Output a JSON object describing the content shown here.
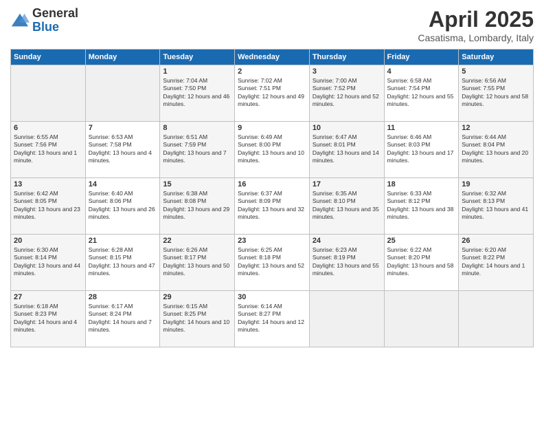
{
  "header": {
    "logo": {
      "general": "General",
      "blue": "Blue"
    },
    "title": "April 2025",
    "subtitle": "Casatisma, Lombardy, Italy"
  },
  "days_of_week": [
    "Sunday",
    "Monday",
    "Tuesday",
    "Wednesday",
    "Thursday",
    "Friday",
    "Saturday"
  ],
  "weeks": [
    [
      null,
      null,
      {
        "day": 1,
        "sunrise": "Sunrise: 7:04 AM",
        "sunset": "Sunset: 7:50 PM",
        "daylight": "Daylight: 12 hours and 46 minutes."
      },
      {
        "day": 2,
        "sunrise": "Sunrise: 7:02 AM",
        "sunset": "Sunset: 7:51 PM",
        "daylight": "Daylight: 12 hours and 49 minutes."
      },
      {
        "day": 3,
        "sunrise": "Sunrise: 7:00 AM",
        "sunset": "Sunset: 7:52 PM",
        "daylight": "Daylight: 12 hours and 52 minutes."
      },
      {
        "day": 4,
        "sunrise": "Sunrise: 6:58 AM",
        "sunset": "Sunset: 7:54 PM",
        "daylight": "Daylight: 12 hours and 55 minutes."
      },
      {
        "day": 5,
        "sunrise": "Sunrise: 6:56 AM",
        "sunset": "Sunset: 7:55 PM",
        "daylight": "Daylight: 12 hours and 58 minutes."
      }
    ],
    [
      {
        "day": 6,
        "sunrise": "Sunrise: 6:55 AM",
        "sunset": "Sunset: 7:56 PM",
        "daylight": "Daylight: 13 hours and 1 minute."
      },
      {
        "day": 7,
        "sunrise": "Sunrise: 6:53 AM",
        "sunset": "Sunset: 7:58 PM",
        "daylight": "Daylight: 13 hours and 4 minutes."
      },
      {
        "day": 8,
        "sunrise": "Sunrise: 6:51 AM",
        "sunset": "Sunset: 7:59 PM",
        "daylight": "Daylight: 13 hours and 7 minutes."
      },
      {
        "day": 9,
        "sunrise": "Sunrise: 6:49 AM",
        "sunset": "Sunset: 8:00 PM",
        "daylight": "Daylight: 13 hours and 10 minutes."
      },
      {
        "day": 10,
        "sunrise": "Sunrise: 6:47 AM",
        "sunset": "Sunset: 8:01 PM",
        "daylight": "Daylight: 13 hours and 14 minutes."
      },
      {
        "day": 11,
        "sunrise": "Sunrise: 6:46 AM",
        "sunset": "Sunset: 8:03 PM",
        "daylight": "Daylight: 13 hours and 17 minutes."
      },
      {
        "day": 12,
        "sunrise": "Sunrise: 6:44 AM",
        "sunset": "Sunset: 8:04 PM",
        "daylight": "Daylight: 13 hours and 20 minutes."
      }
    ],
    [
      {
        "day": 13,
        "sunrise": "Sunrise: 6:42 AM",
        "sunset": "Sunset: 8:05 PM",
        "daylight": "Daylight: 13 hours and 23 minutes."
      },
      {
        "day": 14,
        "sunrise": "Sunrise: 6:40 AM",
        "sunset": "Sunset: 8:06 PM",
        "daylight": "Daylight: 13 hours and 26 minutes."
      },
      {
        "day": 15,
        "sunrise": "Sunrise: 6:38 AM",
        "sunset": "Sunset: 8:08 PM",
        "daylight": "Daylight: 13 hours and 29 minutes."
      },
      {
        "day": 16,
        "sunrise": "Sunrise: 6:37 AM",
        "sunset": "Sunset: 8:09 PM",
        "daylight": "Daylight: 13 hours and 32 minutes."
      },
      {
        "day": 17,
        "sunrise": "Sunrise: 6:35 AM",
        "sunset": "Sunset: 8:10 PM",
        "daylight": "Daylight: 13 hours and 35 minutes."
      },
      {
        "day": 18,
        "sunrise": "Sunrise: 6:33 AM",
        "sunset": "Sunset: 8:12 PM",
        "daylight": "Daylight: 13 hours and 38 minutes."
      },
      {
        "day": 19,
        "sunrise": "Sunrise: 6:32 AM",
        "sunset": "Sunset: 8:13 PM",
        "daylight": "Daylight: 13 hours and 41 minutes."
      }
    ],
    [
      {
        "day": 20,
        "sunrise": "Sunrise: 6:30 AM",
        "sunset": "Sunset: 8:14 PM",
        "daylight": "Daylight: 13 hours and 44 minutes."
      },
      {
        "day": 21,
        "sunrise": "Sunrise: 6:28 AM",
        "sunset": "Sunset: 8:15 PM",
        "daylight": "Daylight: 13 hours and 47 minutes."
      },
      {
        "day": 22,
        "sunrise": "Sunrise: 6:26 AM",
        "sunset": "Sunset: 8:17 PM",
        "daylight": "Daylight: 13 hours and 50 minutes."
      },
      {
        "day": 23,
        "sunrise": "Sunrise: 6:25 AM",
        "sunset": "Sunset: 8:18 PM",
        "daylight": "Daylight: 13 hours and 52 minutes."
      },
      {
        "day": 24,
        "sunrise": "Sunrise: 6:23 AM",
        "sunset": "Sunset: 8:19 PM",
        "daylight": "Daylight: 13 hours and 55 minutes."
      },
      {
        "day": 25,
        "sunrise": "Sunrise: 6:22 AM",
        "sunset": "Sunset: 8:20 PM",
        "daylight": "Daylight: 13 hours and 58 minutes."
      },
      {
        "day": 26,
        "sunrise": "Sunrise: 6:20 AM",
        "sunset": "Sunset: 8:22 PM",
        "daylight": "Daylight: 14 hours and 1 minute."
      }
    ],
    [
      {
        "day": 27,
        "sunrise": "Sunrise: 6:18 AM",
        "sunset": "Sunset: 8:23 PM",
        "daylight": "Daylight: 14 hours and 4 minutes."
      },
      {
        "day": 28,
        "sunrise": "Sunrise: 6:17 AM",
        "sunset": "Sunset: 8:24 PM",
        "daylight": "Daylight: 14 hours and 7 minutes."
      },
      {
        "day": 29,
        "sunrise": "Sunrise: 6:15 AM",
        "sunset": "Sunset: 8:25 PM",
        "daylight": "Daylight: 14 hours and 10 minutes."
      },
      {
        "day": 30,
        "sunrise": "Sunrise: 6:14 AM",
        "sunset": "Sunset: 8:27 PM",
        "daylight": "Daylight: 14 hours and 12 minutes."
      },
      null,
      null,
      null
    ]
  ]
}
